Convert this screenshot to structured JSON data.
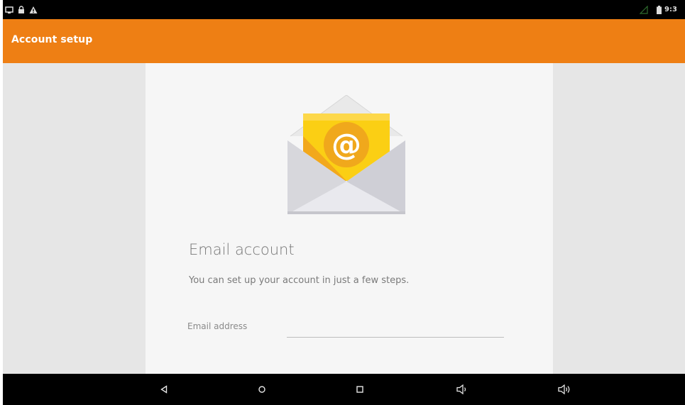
{
  "status_bar": {
    "left_icons": [
      "screen-icon",
      "lock-icon",
      "warning-icon"
    ],
    "right_icons": [
      "signal-icon",
      "battery-icon"
    ],
    "time": "9:3"
  },
  "app_bar": {
    "title": "Account setup",
    "background_color": "#ee7f14"
  },
  "setup": {
    "icon": "email-envelope-icon",
    "title": "Email account",
    "subtitle": "You can set up your account in just a few steps.",
    "email_field": {
      "label": "Email address",
      "value": "",
      "placeholder": ""
    }
  },
  "nav_bar": {
    "buttons": [
      "back-icon",
      "home-icon",
      "recents-icon",
      "volume-down-icon",
      "volume-up-icon"
    ]
  }
}
